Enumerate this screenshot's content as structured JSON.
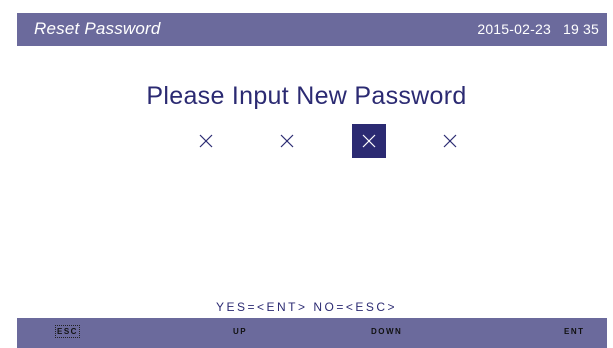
{
  "header": {
    "title": "Reset Password",
    "date": "2015-02-23",
    "time": "19 35"
  },
  "prompt": {
    "heading": "Please Input New Password",
    "slots": [
      {
        "char": "×",
        "selected": false
      },
      {
        "char": "×",
        "selected": false
      },
      {
        "char": "×",
        "selected": true
      },
      {
        "char": "×",
        "selected": false
      }
    ]
  },
  "hint": "YES=<ENT>  NO=<ESC>",
  "keys": {
    "esc": "ESC",
    "up": "UP",
    "down": "DOWN",
    "ent": "ENT"
  },
  "colors": {
    "bar": "#6b6a9c",
    "text": "#2b2a72",
    "selected_slot": "#2b2a72"
  }
}
